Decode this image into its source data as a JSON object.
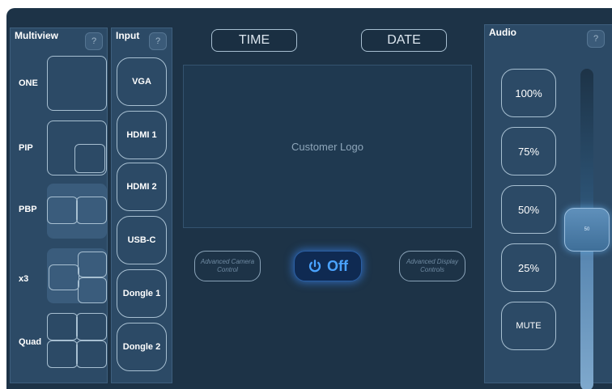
{
  "multiview": {
    "title": "Multiview",
    "help": "?",
    "items": [
      {
        "label": "ONE"
      },
      {
        "label": "PIP"
      },
      {
        "label": "PBP"
      },
      {
        "label": "x3"
      },
      {
        "label": "Quad"
      }
    ]
  },
  "input": {
    "title": "Input",
    "help": "?",
    "items": [
      "VGA",
      "HDMI 1",
      "HDMI 2",
      "USB-C",
      "Dongle 1",
      "Dongle 2"
    ]
  },
  "top": {
    "time": "TIME",
    "date": "DATE"
  },
  "logo": "Customer Logo",
  "advanced_camera": "Advanced Camera Control",
  "advanced_display": "Advanced Display Controls",
  "power": {
    "icon": "power-icon",
    "label": "Off",
    "color": "#4aa3ff"
  },
  "audio": {
    "title": "Audio",
    "help": "?",
    "presets": [
      "100%",
      "75%",
      "50%",
      "25%"
    ],
    "mute": "MUTE",
    "slider_value": "50",
    "level": 0.5
  }
}
